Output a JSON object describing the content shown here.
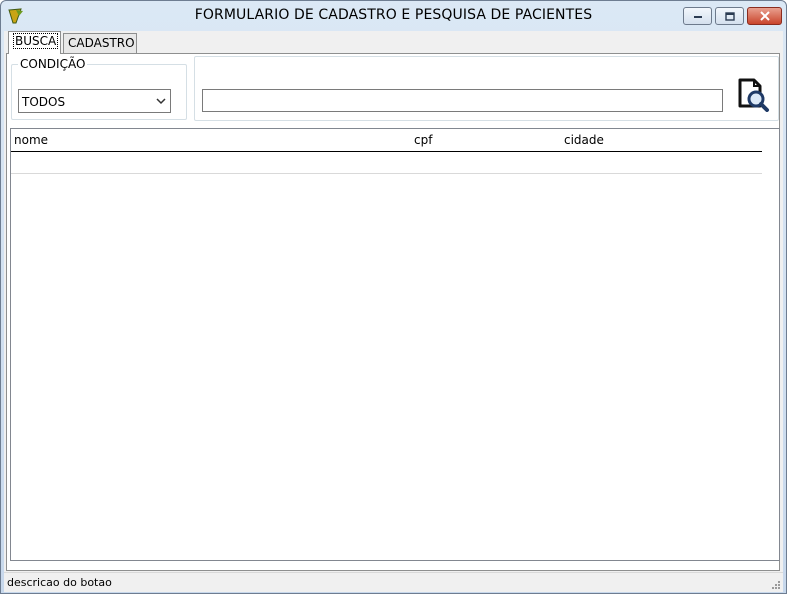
{
  "window": {
    "title": "FORMULARIO DE CADASTRO E PESQUISA DE PACIENTES",
    "icon": "app-logo-icon"
  },
  "tabs": [
    {
      "label": "BUSCA",
      "active": true
    },
    {
      "label": "CADASTRO",
      "active": false
    }
  ],
  "busca": {
    "condition_label": "CONDIÇÃO",
    "condition_value": "TODOS",
    "search_value": "",
    "search_icon": "document-search-icon"
  },
  "grid": {
    "columns": [
      "nome",
      "cpf",
      "cidade"
    ],
    "rows": []
  },
  "status": {
    "text": "descricao do botao"
  },
  "colors": {
    "panel_bg": "#ffffff",
    "form_bg": "#f0f0f0",
    "close_button": "#c9452c",
    "title_gradient": "#dbe8f5"
  }
}
